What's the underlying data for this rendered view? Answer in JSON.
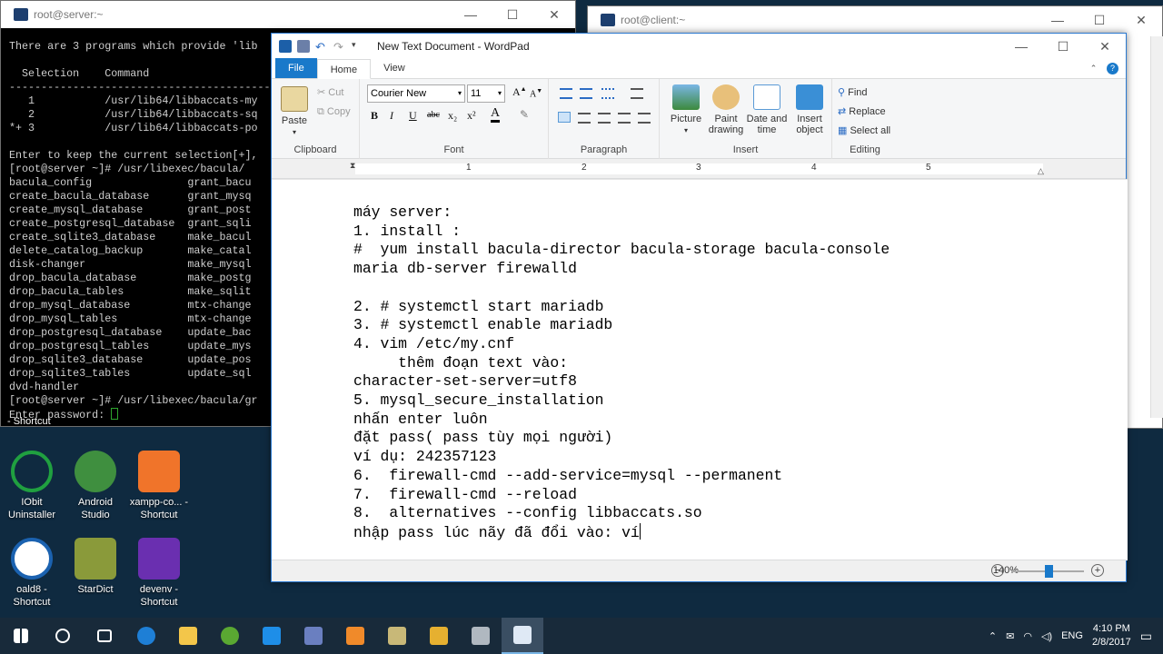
{
  "terminal_server": {
    "title": "root@server:~",
    "lines": [
      "There are 3 programs which provide 'lib",
      "",
      "  Selection    Command",
      "-----------------------------------------",
      "   1           /usr/lib64/libbaccats-my",
      "   2           /usr/lib64/libbaccats-sq",
      "*+ 3           /usr/lib64/libbaccats-po",
      "",
      "Enter to keep the current selection[+],",
      "[root@server ~]# /usr/libexec/bacula/",
      "bacula_config               grant_bacu",
      "create_bacula_database      grant_mysq",
      "create_mysql_database       grant_post",
      "create_postgresql_database  grant_sqli",
      "create_sqlite3_database     make_bacul",
      "delete_catalog_backup       make_catal",
      "disk-changer                make_mysql",
      "drop_bacula_database        make_postg",
      "drop_bacula_tables          make_sqlit",
      "drop_mysql_database         mtx-change",
      "drop_mysql_tables           mtx-change",
      "drop_postgresql_database    update_bac",
      "drop_postgresql_tables      update_mys",
      "drop_sqlite3_database       update_pos",
      "drop_sqlite3_tables         update_sql",
      "dvd-handler",
      "[root@server ~]# /usr/libexec/bacula/gr"
    ],
    "prompt": "Enter password: "
  },
  "terminal_client": {
    "title": "root@client:~"
  },
  "desktop": {
    "stub_label": "- Shortcut",
    "icons": [
      {
        "name": "IObit Uninstaller",
        "color": "#20a040"
      },
      {
        "name": "Android Studio",
        "color": "#3f8f3f"
      },
      {
        "name": "xampp-co... - Shortcut",
        "color": "#f0742a"
      },
      {
        "name": "oald8 - Shortcut",
        "color": "#1b62b0"
      },
      {
        "name": "StarDict",
        "color": "#8a9a3a"
      },
      {
        "name": "devenv - Shortcut",
        "color": "#6a2fb0"
      }
    ]
  },
  "wordpad": {
    "title": "New Text Document - WordPad",
    "tabs": {
      "file": "File",
      "home": "Home",
      "view": "View"
    },
    "clipboard": {
      "paste": "Paste",
      "cut": "Cut",
      "copy": "Copy",
      "label": "Clipboard"
    },
    "font": {
      "family": "Courier New",
      "size": "11",
      "label": "Font",
      "bold": "B",
      "italic": "I",
      "underline": "U",
      "strike": "abc",
      "sub": "x₂",
      "sup": "x²",
      "color": "A"
    },
    "paragraph": {
      "label": "Paragraph"
    },
    "insert": {
      "picture": "Picture",
      "paint": "Paint drawing",
      "datetime": "Date and time",
      "object": "Insert object",
      "label": "Insert"
    },
    "editing": {
      "find": "Find",
      "replace": "Replace",
      "select_all": "Select all",
      "label": "Editing"
    },
    "ruler_numbers": [
      "1",
      "2",
      "3",
      "4",
      "5"
    ],
    "document": "máy server:\n1. install :\n#  yum install bacula-director bacula-storage bacula-console\nmaria db-server firewalld\n\n2. # systemctl start mariadb\n3. # systemctl enable mariadb\n4. vim /etc/my.cnf\n     thêm đoạn text vào:\ncharacter-set-server=utf8\n5. mysql_secure_installation\nnhấn enter luôn\nđặt pass( pass tùy mọi người)\nví dụ: 242357123\n6.  firewall-cmd --add-service=mysql --permanent\n7.  firewall-cmd --reload\n8.  alternatives --config libbaccats.so\nnhập pass lúc nãy đã đổi vào: ví",
    "zoom": "140%"
  },
  "taskbar": {
    "language": "ENG",
    "time": "4:10 PM",
    "date": "2/8/2017",
    "pinned": [
      "windows-start",
      "cortana",
      "task-view",
      "edge",
      "file-explorer",
      "app-green",
      "zalo",
      "network-app",
      "media-app",
      "app-a",
      "app-b",
      "app-c",
      "wordpad"
    ]
  }
}
